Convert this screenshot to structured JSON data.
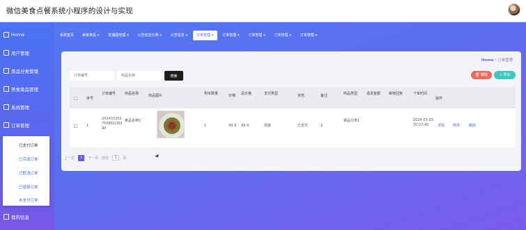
{
  "app": {
    "title": "微信美食点餐系统小程序的设计与实现"
  },
  "sidebar": {
    "items": [
      {
        "label": "Home",
        "icon": "home-icon"
      },
      {
        "label": "用户管理",
        "icon": "users-icon"
      },
      {
        "label": "菜品分类管理",
        "icon": "category-icon"
      },
      {
        "label": "美食菜品管理",
        "icon": "dish-icon"
      },
      {
        "label": "系统管理",
        "icon": "system-icon"
      },
      {
        "label": "订单管理",
        "icon": "order-icon"
      },
      {
        "label": "我的信息",
        "icon": "profile-icon"
      }
    ],
    "submenu": [
      "已支付订单",
      "已完成订单",
      "已取消订单",
      "已退款订单",
      "未支付订单"
    ]
  },
  "tabs": [
    {
      "label": "系统首页",
      "closable": false
    },
    {
      "label": "美食菜品",
      "closable": true
    },
    {
      "label": "轮播图管理",
      "closable": true
    },
    {
      "label": "公告信息分类",
      "closable": true
    },
    {
      "label": "公告信息",
      "closable": true
    },
    {
      "label": "订单管理",
      "closable": true
    },
    {
      "label": "订单管理",
      "closable": true
    },
    {
      "label": "订单管理",
      "closable": true
    },
    {
      "label": "订单管理",
      "closable": true
    },
    {
      "label": "订单管理",
      "closable": true
    }
  ],
  "tab_close": "×",
  "breadcrumb": {
    "home": "Home",
    "separator": "/",
    "current": "订单管理"
  },
  "search": {
    "order_no_placeholder": "订单编号",
    "dish_name_placeholder": "商品名称",
    "button": "搜索"
  },
  "actions": {
    "delete": "删除",
    "export": "导出"
  },
  "table": {
    "headers": [
      "序号",
      "订单编号",
      "商品名称",
      "商品图片",
      "购买数量",
      "价格",
      "总价格",
      "支付类型",
      "状态",
      "备注",
      "商品类型",
      "退货金额",
      "审核回复",
      "下单时间",
      "操作"
    ],
    "rows": [
      {
        "index": "1",
        "order_no": "202433202750861O9390",
        "dish_name": "菜品名称1",
        "quantity": "1",
        "price": "99.9",
        "total": "99.9",
        "pay_type": "现金",
        "status": "已支付",
        "remark": "2",
        "dish_type": "菜品分类1",
        "refund": "",
        "audit_reply": "",
        "order_time": "2024-03-03 20:27:45",
        "ops": [
          "详情",
          "修改",
          "删除"
        ]
      }
    ]
  },
  "pagination": {
    "prev": "上一页",
    "current": "1",
    "next": "下一页",
    "goto_label": "前往",
    "page_input": "1",
    "page_unit": "页"
  },
  "colors": {
    "accent": "#5a6be8",
    "delete": "#ee6a5a",
    "export": "#3ec6c0",
    "link": "#4a6ee0"
  }
}
